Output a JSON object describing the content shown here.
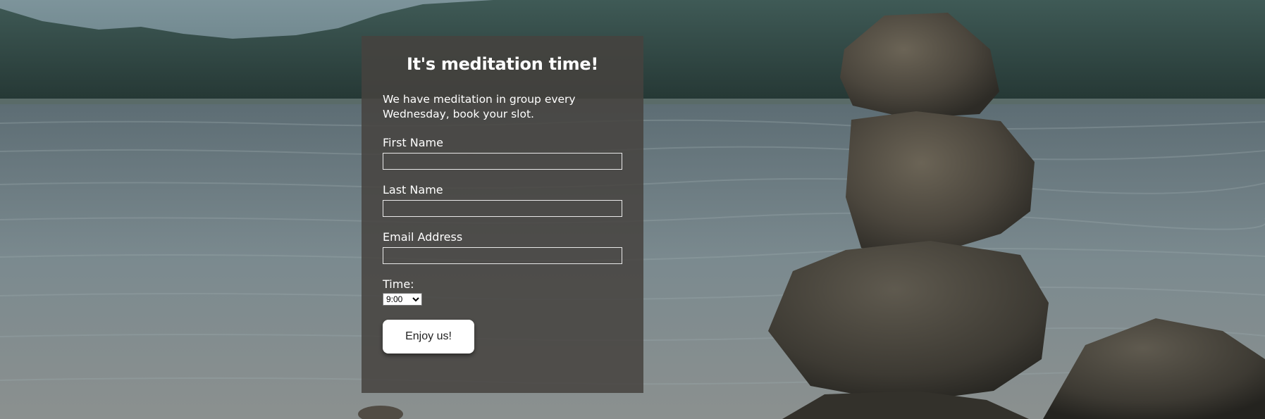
{
  "form": {
    "title": "It's meditation time!",
    "intro": "We have meditation in group every Wednesday, book your slot.",
    "fields": {
      "first_name": {
        "label": "First Name",
        "value": ""
      },
      "last_name": {
        "label": "Last Name",
        "value": ""
      },
      "email": {
        "label": "Email Address",
        "value": ""
      }
    },
    "time": {
      "label": "Time:",
      "selected": "9:00"
    },
    "submit_label": "Enjoy us!"
  },
  "colors": {
    "panel": "#46423f",
    "water": "#6d7b80",
    "forest": "#2f4440",
    "sky": "#6e8790",
    "rocks": "#4a453c",
    "button": "#ffffff"
  }
}
